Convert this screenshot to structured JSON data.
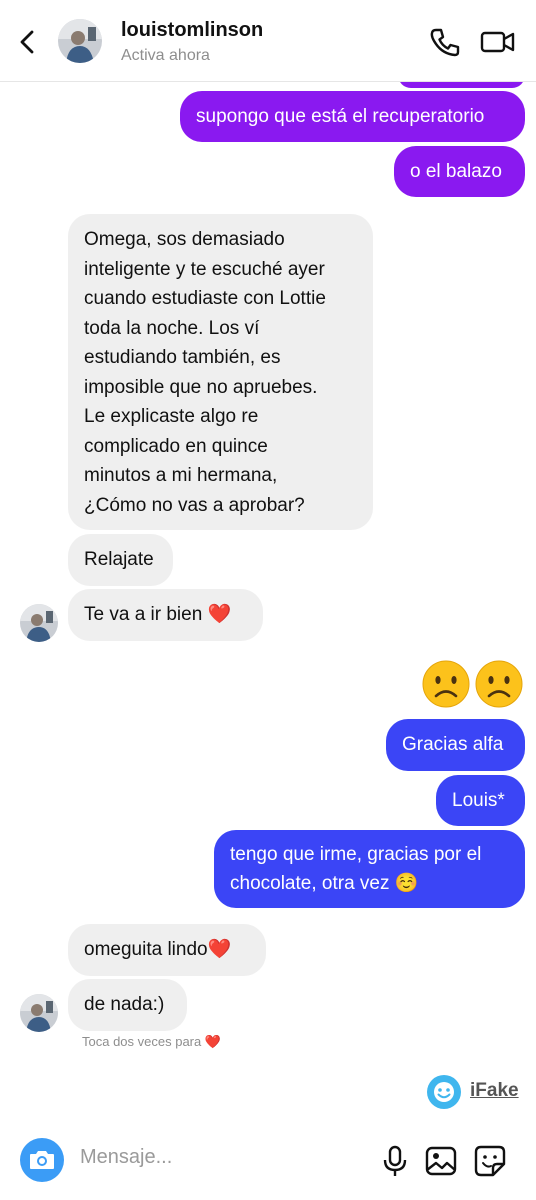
{
  "header": {
    "username": "louistomlinson",
    "status": "Activa ahora"
  },
  "messages": [
    {
      "side": "right",
      "color": "purple",
      "text": "supongo que está el recuperatorio"
    },
    {
      "side": "right",
      "color": "purple",
      "text": "o el balazo"
    },
    {
      "side": "left",
      "text": "Omega, sos demasiado\ninteligente y te escuché ayer\ncuando estudiaste con Lottie\ntoda la noche. Los ví\nestudiando también, es\nimposible que no apruebes.\nLe explicaste algo re\ncomplicado en quince\nminutos a mi hermana,\n¿Cómo no vas a aprobar?"
    },
    {
      "side": "left",
      "text": "Relajate"
    },
    {
      "side": "left",
      "text": "Te va a ir bien ❤️"
    },
    {
      "side": "right",
      "color": "emoji",
      "text": "🙁🙁"
    },
    {
      "side": "right",
      "color": "blue",
      "text": "Gracias alfa"
    },
    {
      "side": "right",
      "color": "blue",
      "text": "Louis*"
    },
    {
      "side": "right",
      "color": "blue",
      "text": "tengo que irme, gracias por el\nchocolate, otra vez ☺️"
    },
    {
      "side": "left",
      "text": "omeguita lindo❤️"
    },
    {
      "side": "left",
      "text": "de nada:)"
    }
  ],
  "seen_hint": "Toca dos veces para ❤️",
  "watermark": "iFake",
  "composer": {
    "placeholder": "Mensaje..."
  },
  "icons": [
    "back-arrow-icon",
    "phone-icon",
    "video-camera-icon",
    "camera-icon",
    "microphone-icon",
    "gallery-icon",
    "sticker-icon"
  ]
}
